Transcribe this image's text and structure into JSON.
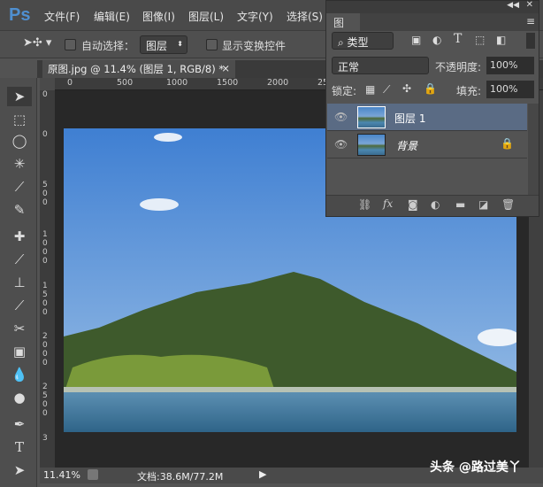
{
  "app": {
    "logo": "Ps"
  },
  "menu": [
    "文件(F)",
    "编辑(E)",
    "图像(I)",
    "图层(L)",
    "文字(Y)",
    "选择(S)"
  ],
  "options": {
    "auto_select_label": "自动选择：",
    "auto_select_value": "图层",
    "show_transform_label": "显示变换控件"
  },
  "document_tab": {
    "title": "原图.jpg @ 11.4% (图层 1, RGB/8) *",
    "close": "×"
  },
  "ruler_h": [
    "0",
    "500",
    "1000",
    "1500",
    "2000",
    "25"
  ],
  "ruler_v": [
    "0",
    "0",
    "500",
    "1000",
    "1500",
    "2000",
    "2500",
    "3"
  ],
  "status": {
    "zoom": "11.41%",
    "doc": "文档:38.6M/77.2M"
  },
  "watermark": "头条 @路过美丫",
  "layers_panel": {
    "tab": "图层",
    "filter_type": "类型",
    "blend_mode": "正常",
    "opacity_label": "不透明度:",
    "opacity": "100%",
    "lock_label": "锁定:",
    "fill_label": "填充:",
    "fill": "100%",
    "layers": [
      {
        "name": "图层 1",
        "selected": true
      },
      {
        "name": "背景",
        "locked": true
      }
    ],
    "fx_label": "fx"
  }
}
